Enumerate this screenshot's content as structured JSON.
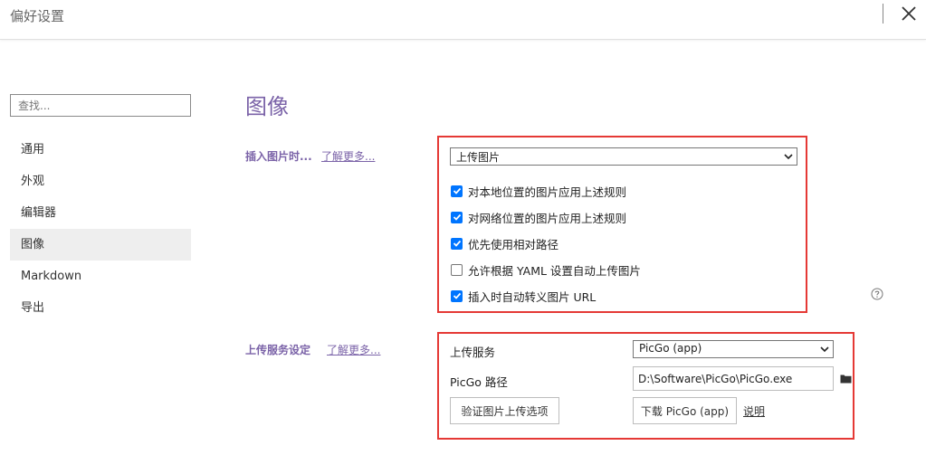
{
  "window": {
    "title": "偏好设置"
  },
  "sidebar": {
    "search_placeholder": "查找...",
    "items": [
      {
        "label": "通用",
        "active": false
      },
      {
        "label": "外观",
        "active": false
      },
      {
        "label": "编辑器",
        "active": false
      },
      {
        "label": "图像",
        "active": true
      },
      {
        "label": "Markdown",
        "active": false
      },
      {
        "label": "导出",
        "active": false
      }
    ]
  },
  "main": {
    "title": "图像",
    "insert_section": {
      "label": "插入图片时...",
      "learn_more": "了解更多...",
      "select_value": "上传图片",
      "checkboxes": [
        {
          "label": "对本地位置的图片应用上述规则",
          "checked": true
        },
        {
          "label": "对网络位置的图片应用上述规则",
          "checked": true
        },
        {
          "label": "优先使用相对路径",
          "checked": true
        },
        {
          "label": "允许根据 YAML 设置自动上传图片",
          "checked": false
        },
        {
          "label": "插入时自动转义图片 URL",
          "checked": true
        }
      ]
    },
    "upload_section": {
      "label": "上传服务设定",
      "learn_more": "了解更多...",
      "service_label": "上传服务",
      "service_value": "PicGo (app)",
      "path_label": "PicGo 路径",
      "path_value": "D:\\Software\\PicGo\\PicGo.exe",
      "verify_button": "验证图片上传选项",
      "download_button": "下载 PicGo (app)",
      "explain_link": "说明"
    }
  },
  "colors": {
    "accent": "#7b63a8",
    "highlight_border": "#e53935",
    "checkbox": "#0075ff"
  },
  "icons": [
    "close-icon",
    "chevron-down-icon",
    "check-icon",
    "help-icon",
    "folder-icon"
  ]
}
